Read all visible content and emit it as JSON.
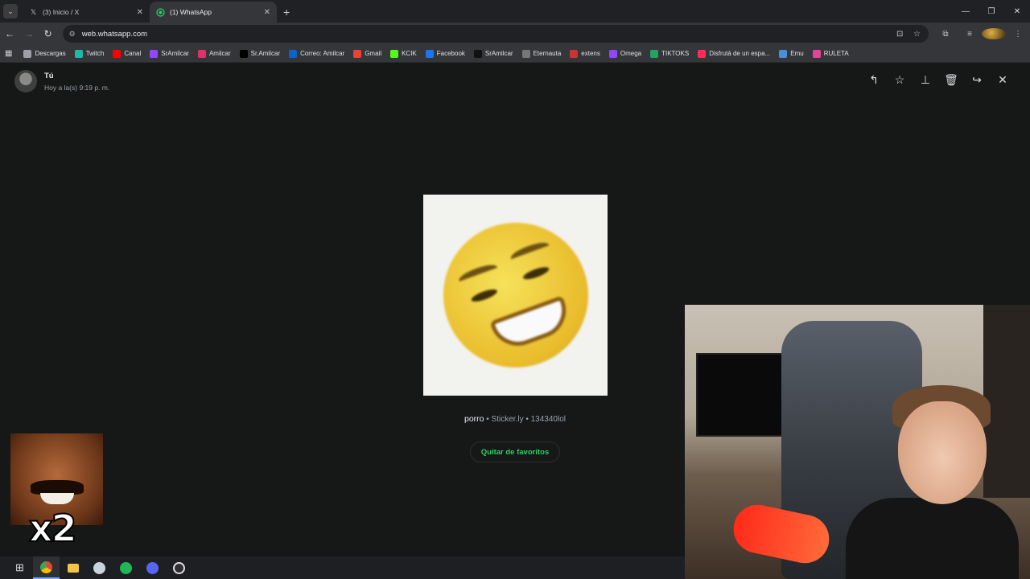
{
  "browser": {
    "tabs": [
      {
        "title": "(3) Inicio / X",
        "icon": "x-logo",
        "active": false
      },
      {
        "title": "(1) WhatsApp",
        "icon": "whatsapp-logo",
        "active": true
      }
    ],
    "url": "web.whatsapp.com",
    "bookmarks": [
      {
        "label": "Descargas",
        "icon": "download",
        "color": "#9aa0a6"
      },
      {
        "label": "Twitch",
        "icon": "t",
        "color": "#21b7a5"
      },
      {
        "label": "Canal",
        "icon": "youtube",
        "color": "#ff0000"
      },
      {
        "label": "SrAmilcar",
        "icon": "twitch",
        "color": "#9146ff"
      },
      {
        "label": "Amilcar",
        "icon": "instagram",
        "color": "#e1306c"
      },
      {
        "label": "Sr.Amilcar",
        "icon": "x",
        "color": "#000000"
      },
      {
        "label": "Correo: Amilcar",
        "icon": "outlook",
        "color": "#0a64c8"
      },
      {
        "label": "Gmail",
        "icon": "gmail",
        "color": "#ea4335"
      },
      {
        "label": "KCIK",
        "icon": "kick",
        "color": "#53fc18"
      },
      {
        "label": "Facebook",
        "icon": "facebook",
        "color": "#1877f2"
      },
      {
        "label": "SrAmilcar",
        "icon": "tiktok",
        "color": "#111111"
      },
      {
        "label": "Eternauta",
        "icon": "doc",
        "color": "#777777"
      },
      {
        "label": "extens",
        "icon": "puzzle",
        "color": "#cc3333"
      },
      {
        "label": "Omega",
        "icon": "twitch",
        "color": "#9146ff"
      },
      {
        "label": "TIKTOKS",
        "icon": "drive",
        "color": "#1fa463"
      },
      {
        "label": "Disfrutá de un espa...",
        "icon": "a",
        "color": "#ff2a5a"
      },
      {
        "label": "Emu",
        "icon": "emu",
        "color": "#4a8fd8"
      },
      {
        "label": "RULETA",
        "icon": "grid",
        "color": "#e84393"
      }
    ]
  },
  "viewer": {
    "sender_name": "Tú",
    "timestamp": "Hoy a la(s) 9:19 p. m.",
    "actions": [
      "reply",
      "star",
      "pin",
      "delete",
      "forward",
      "close"
    ],
    "sticker": {
      "name": "porro",
      "meta": " • Sticker.ly • 134340lol"
    },
    "favorite_button": "Quitar de favoritos"
  },
  "taskbar": {
    "items": [
      "windows-start",
      "chrome",
      "file-explorer",
      "steam",
      "spotify",
      "discord",
      "obs"
    ]
  },
  "overlay": {
    "multiplier": "x2"
  },
  "colors": {
    "accent": "#25d366",
    "background": "#161717"
  }
}
